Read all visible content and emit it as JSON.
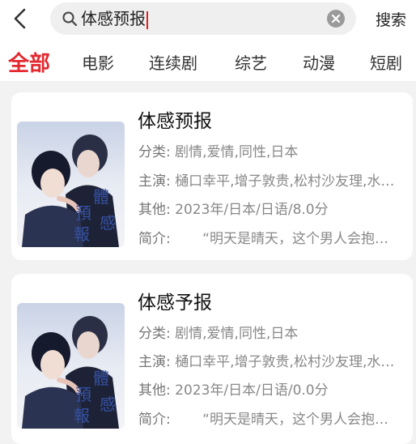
{
  "search": {
    "query": "体感预报",
    "button_label": "搜索"
  },
  "tabs": [
    {
      "label": "全部",
      "active": true
    },
    {
      "label": "电影"
    },
    {
      "label": "连续剧"
    },
    {
      "label": "综艺"
    },
    {
      "label": "动漫"
    },
    {
      "label": "短剧"
    }
  ],
  "results": [
    {
      "title": "体感预报",
      "category_label": "分类:",
      "category": "剧情,爱情,同性,日本",
      "cast_label": "主演:",
      "cast": "樋口幸平,增子敦贵,松村沙友理,水…",
      "other_label": "其他:",
      "other": "2023年/日本/日语/8.0分",
      "intro_label": "简介:",
      "intro": "“明天是晴天，这个男人会抱…",
      "poster_text": [
        "體",
        "感",
        "預",
        "報"
      ]
    },
    {
      "title": "体感予报",
      "category_label": "分类:",
      "category": "剧情,爱情,同性,日本",
      "cast_label": "主演:",
      "cast": "樋口幸平,增子敦贵,松村沙友理,水…",
      "other_label": "其他:",
      "other": "2023年/日本/日语/0.0分",
      "intro_label": "简介:",
      "intro": "“明天是晴天，这个男人会抱…",
      "poster_text": [
        "體",
        "感",
        "預",
        "報"
      ]
    }
  ],
  "colors": {
    "accent": "#e3282f",
    "background": "#f2f2f2",
    "card": "#ffffff"
  }
}
